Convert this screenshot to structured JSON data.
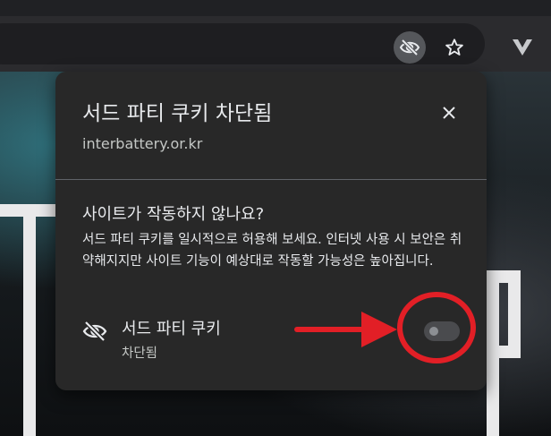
{
  "popup": {
    "title": "서드 파티 쿠키 차단됨",
    "domain": "interbattery.or.kr",
    "question_title": "사이트가 작동하지 않나요?",
    "question_body": "서드 파티 쿠키를 일시적으로 허용해 보세요. 인터넷 사용 시 보안은 취약해지지만 사이트 기능이 예상대로 작동할 가능성은 높아집니다.",
    "cookie_setting": {
      "label": "서드 파티 쿠키",
      "status": "차단됨",
      "enabled": false
    }
  },
  "toolbar": {
    "icons": [
      "eye-off-icon",
      "star-icon",
      "extension-v-icon"
    ]
  },
  "colors": {
    "popup_bg": "#282828",
    "annotation_red": "#e21f26",
    "text_primary": "#e8eaed"
  }
}
